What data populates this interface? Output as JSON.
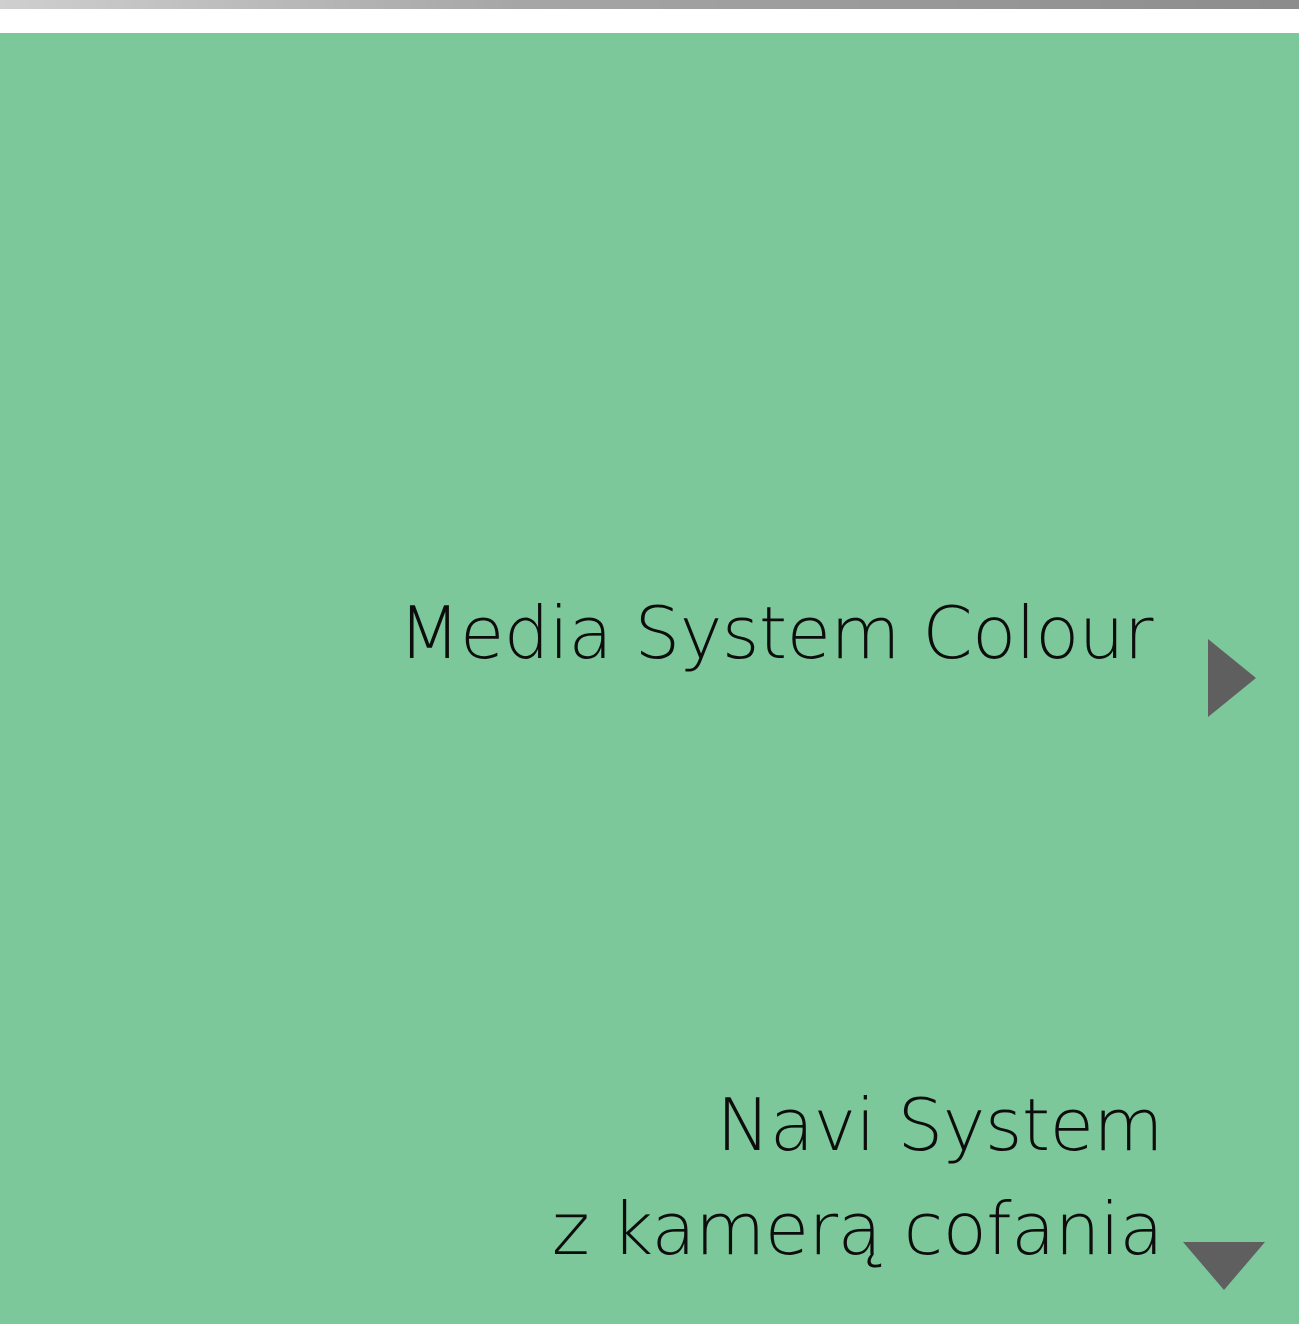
{
  "options": {
    "media": {
      "label": "Media System Colour",
      "icon": "triangle-right-icon"
    },
    "navi": {
      "line1": "Navi System",
      "line2": "z kamerą cofania",
      "icon": "triangle-down-icon"
    }
  },
  "colors": {
    "panel_background": "#7cc89a",
    "text": "#0d0d0d",
    "icon": "#5f5f5f"
  }
}
